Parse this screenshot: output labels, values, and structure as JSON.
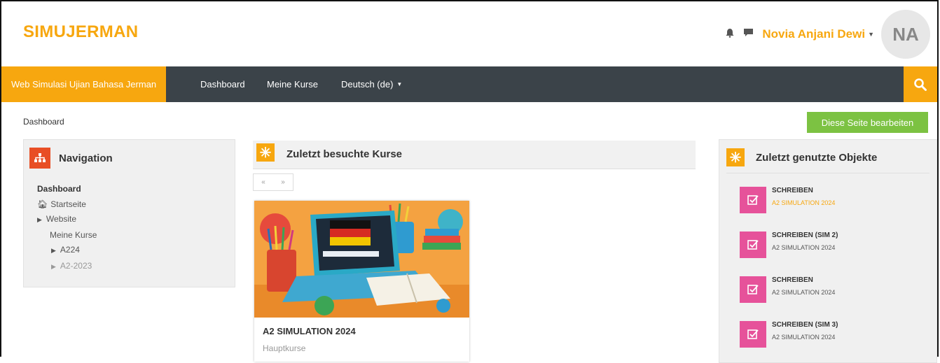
{
  "header": {
    "brand": "SIMUJERMAN",
    "user_name": "Novia Anjani Dewi",
    "avatar_initials": "NA",
    "icons": [
      "notification-icon",
      "message-icon"
    ]
  },
  "navbar": {
    "items": [
      {
        "label": "Web Simulasi Ujian Bahasa Jerman",
        "active": true
      },
      {
        "label": "Dashboard"
      },
      {
        "label": "Meine Kurse"
      },
      {
        "label": "Deutsch (de)",
        "dropdown": true
      }
    ],
    "search_icon": "search-icon"
  },
  "breadcrumb": "Dashboard",
  "edit_button": "Diese Seite bearbeiten",
  "navigation": {
    "title": "Navigation",
    "items": [
      {
        "label": "Dashboard"
      },
      {
        "label": "Startseite"
      },
      {
        "label": "Website"
      },
      {
        "label": "Meine Kurse"
      },
      {
        "label": "A224"
      },
      {
        "label": "A2-2023"
      }
    ]
  },
  "recent_courses": {
    "title": "Zuletzt besuchte Kurse",
    "pager": [
      "«",
      "»"
    ],
    "courses": [
      {
        "name": "A2 SIMULATION 2024",
        "category": "Hauptkurse"
      }
    ]
  },
  "recent_items": {
    "title": "Zuletzt genutzte Objekte",
    "items": [
      {
        "title": "SCHREIBEN",
        "course": "A2 SIMULATION 2024"
      },
      {
        "title": "SCHREIBEN (SIM 2)",
        "course": "A2 SIMULATION 2024"
      },
      {
        "title": "SCHREIBEN",
        "course": "A2 SIMULATION 2024"
      },
      {
        "title": "SCHREIBEN (SIM 3)",
        "course": "A2 SIMULATION 2024"
      }
    ]
  },
  "colors": {
    "accent": "#f7a70f",
    "navbar": "#3b4349",
    "edit_button": "#7cc242",
    "assignment_icon": "#e6529a",
    "nav_icon": "#e84e24",
    "link_hover": "#f7a70f"
  }
}
